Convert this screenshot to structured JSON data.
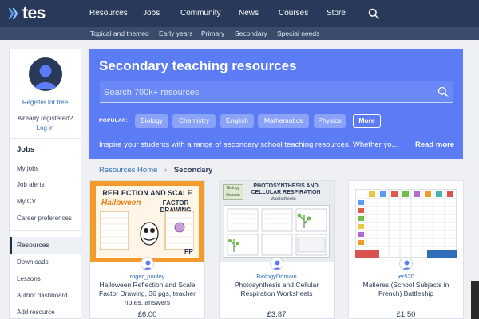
{
  "header": {
    "logo_text": "tes",
    "nav": [
      "Resources",
      "Jobs",
      "Community",
      "News",
      "Courses",
      "Store"
    ],
    "subnav": [
      "Topical and themed",
      "Early years",
      "Primary",
      "Secondary",
      "Special needs"
    ]
  },
  "sidebar": {
    "register_label": "Register for free",
    "already_registered": "Already registered?",
    "login_label": "Log in",
    "jobs_heading": "Jobs",
    "jobs_items": [
      "My jobs",
      "Job alerts",
      "My CV",
      "Career preferences"
    ],
    "resources_label": "Resources",
    "resources_items": [
      "Downloads",
      "Lessons",
      "Author dashboard",
      "Add resource"
    ]
  },
  "hero": {
    "title": "Secondary teaching resources",
    "search_placeholder": "Search 700k+ resources",
    "popular_label": "POPULAR:",
    "popular": [
      "Biology",
      "Chemistry",
      "English",
      "Mathematics",
      "Physics"
    ],
    "more_label": "More",
    "description": "Inspire your students with a range of secondary school teaching resources. Whether yo...",
    "read_more": "Read more"
  },
  "breadcrumb": {
    "home": "Resources Home",
    "separator": "›",
    "current": "Secondary"
  },
  "cards": [
    {
      "author": "roger_pooley",
      "title": "Halloween Reflection and Scale Factor Drawing, 36 pgs, teacher notes, answers",
      "price": "£6.00",
      "thumb_title": "REFLECTION AND SCALE",
      "thumb_sub1": "Halloween",
      "thumb_sub2": "FACTOR DRAWING",
      "thumb_badge": "PP"
    },
    {
      "author": "BiologyDomain",
      "title": "Photosynthesis and Cellular Respiration Worksheets",
      "price": "£3.87",
      "thumb_title": "PHOTOSYNTHESIS AND CELLULAR RESPIRATION",
      "thumb_sub": "Worksheets",
      "thumb_logo": "Biology Domain"
    },
    {
      "author": "jer520",
      "title": "Matières (School Subjects in French) Battleship",
      "price": "£1.50"
    }
  ],
  "colors": {
    "nav_bg": "#28395a",
    "subnav_bg": "#3a4b6c",
    "hero_bg": "#5b7cf4",
    "link": "#2f6fb8",
    "page_bg": "#eef0f4"
  }
}
